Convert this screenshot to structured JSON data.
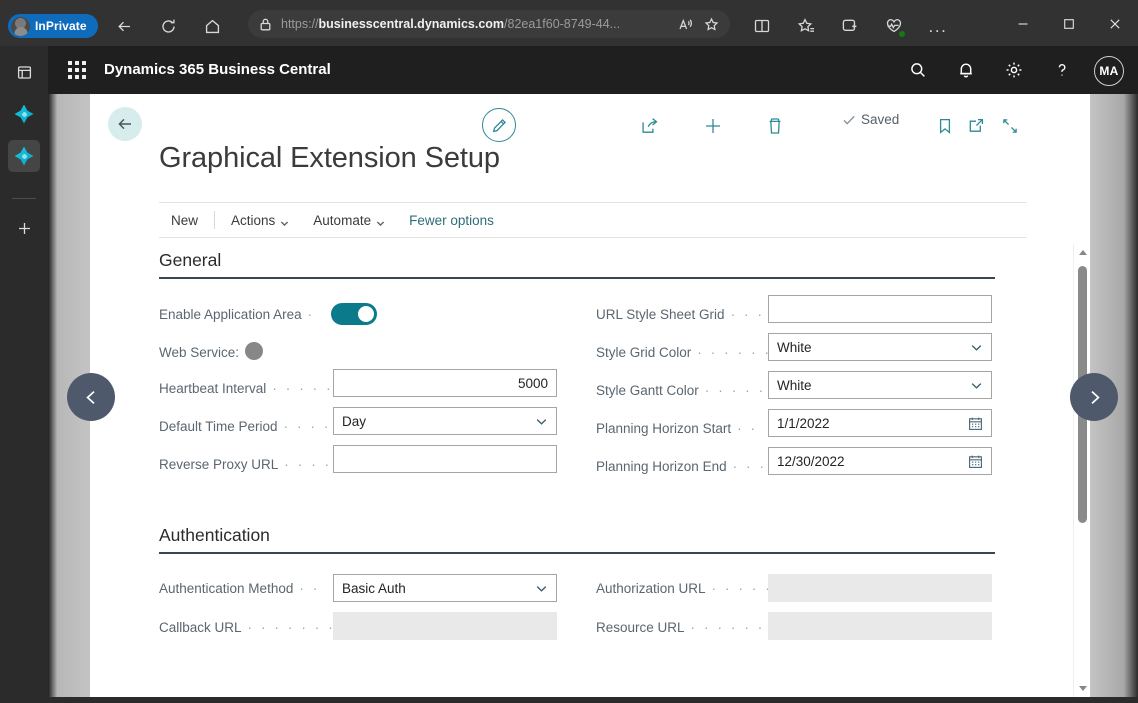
{
  "browser": {
    "profile_badge": "InPrivate",
    "url_prefix": "https://",
    "url_domain": "businesscentral.dynamics.com",
    "url_path": "/82ea1f60-8749-44...",
    "nav": {
      "back": "back-arrow",
      "refresh": "refresh",
      "home": "home"
    },
    "omnibox_icons": {
      "lock": "lock",
      "read_aloud": "read-aloud",
      "favorite": "star"
    },
    "toolbar_icons": {
      "split_screen": "split-screen",
      "favorites": "favorites",
      "collections": "collections",
      "browser_essentials": "browser-essentials",
      "settings_more": "..."
    },
    "window_controls": {
      "minimize": "minimize",
      "maximize": "maximize",
      "close": "close"
    }
  },
  "edge_sidebar": {
    "items": [
      {
        "name": "tab-actions",
        "icon": "window-icon",
        "active": false
      },
      {
        "name": "app-1",
        "icon": "diamond-app-icon",
        "active": false
      },
      {
        "name": "app-2",
        "icon": "diamond-app-icon",
        "active": true
      },
      {
        "name": "add-sidebar-app",
        "icon": "plus-icon",
        "active": false
      }
    ]
  },
  "app_header": {
    "waffle": "app-launcher",
    "title": "Dynamics 365 Business Central",
    "icons": [
      {
        "name": "search-icon",
        "glyph": "search"
      },
      {
        "name": "notifications-icon",
        "glyph": "bell"
      },
      {
        "name": "settings-icon",
        "glyph": "gear"
      },
      {
        "name": "help-icon",
        "glyph": "question"
      }
    ],
    "avatar_initials": "MA"
  },
  "page": {
    "back": "back-arrow",
    "toolbar": {
      "edit": "edit-pencil",
      "share": "share",
      "new": "plus",
      "delete": "trash",
      "saved_label": "Saved",
      "bookmark": "bookmark",
      "open_new_window": "open-in-new-window",
      "collapse": "collapse-arrows"
    },
    "title": "Graphical Extension Setup",
    "menu": [
      {
        "label": "New",
        "has_caret": false,
        "link": false
      },
      {
        "label": "Actions",
        "has_caret": true,
        "link": false
      },
      {
        "label": "Automate",
        "has_caret": true,
        "link": false
      },
      {
        "label": "Fewer options",
        "has_caret": false,
        "link": true
      }
    ],
    "nav_prev": "previous-record",
    "nav_next": "next-record"
  },
  "sections": [
    {
      "name": "general",
      "heading": "General",
      "left_fields": [
        {
          "label": "Enable Application Area",
          "type": "toggle",
          "value": "on",
          "leader": "·"
        },
        {
          "label": "Web Service:",
          "type": "status",
          "value": "gray",
          "leader": ""
        },
        {
          "label": "Heartbeat Interval",
          "type": "text",
          "value": "5000",
          "align": "right",
          "leader": "· · · · · ·"
        },
        {
          "label": "Default Time Period",
          "type": "select",
          "value": "Day",
          "leader": "· · · · ·"
        },
        {
          "label": "Reverse Proxy URL",
          "type": "text",
          "value": "",
          "leader": "· · · · · ·"
        }
      ],
      "right_fields": [
        {
          "label": "URL Style Sheet Grid",
          "type": "text",
          "value": "",
          "leader": "· · · ·"
        },
        {
          "label": "Style Grid Color",
          "type": "select",
          "value": "White",
          "leader": "· · · · · · · ·"
        },
        {
          "label": "Style Gantt Color",
          "type": "select",
          "value": "White",
          "leader": "· · · · · · ·"
        },
        {
          "label": "Planning Horizon Start",
          "type": "date",
          "value": "1/1/2022",
          "leader": "· ·"
        },
        {
          "label": "Planning Horizon End",
          "type": "date",
          "value": "12/30/2022",
          "leader": "· · ·"
        }
      ]
    },
    {
      "name": "authentication",
      "heading": "Authentication",
      "left_fields": [
        {
          "label": "Authentication Method",
          "type": "select",
          "value": "Basic Auth",
          "leader": "· ·"
        },
        {
          "label": "Callback URL",
          "type": "text",
          "value": "",
          "disabled": true,
          "leader": "· · · · · · · · ·"
        }
      ],
      "right_fields": [
        {
          "label": "Authorization URL",
          "type": "text",
          "value": "",
          "disabled": true,
          "leader": "· · · · · ·"
        },
        {
          "label": "Resource URL",
          "type": "text",
          "value": "",
          "disabled": true,
          "leader": "· · · · · · · ·"
        }
      ]
    }
  ],
  "colors": {
    "accent_teal": "#0b7a8b",
    "toolbar_teal": "#2c8a95",
    "back_circle": "#d6eced",
    "page_nav": "#4e5a6b",
    "section_rule": "#3b4654",
    "inprivate_blue": "#0f6cbd"
  }
}
